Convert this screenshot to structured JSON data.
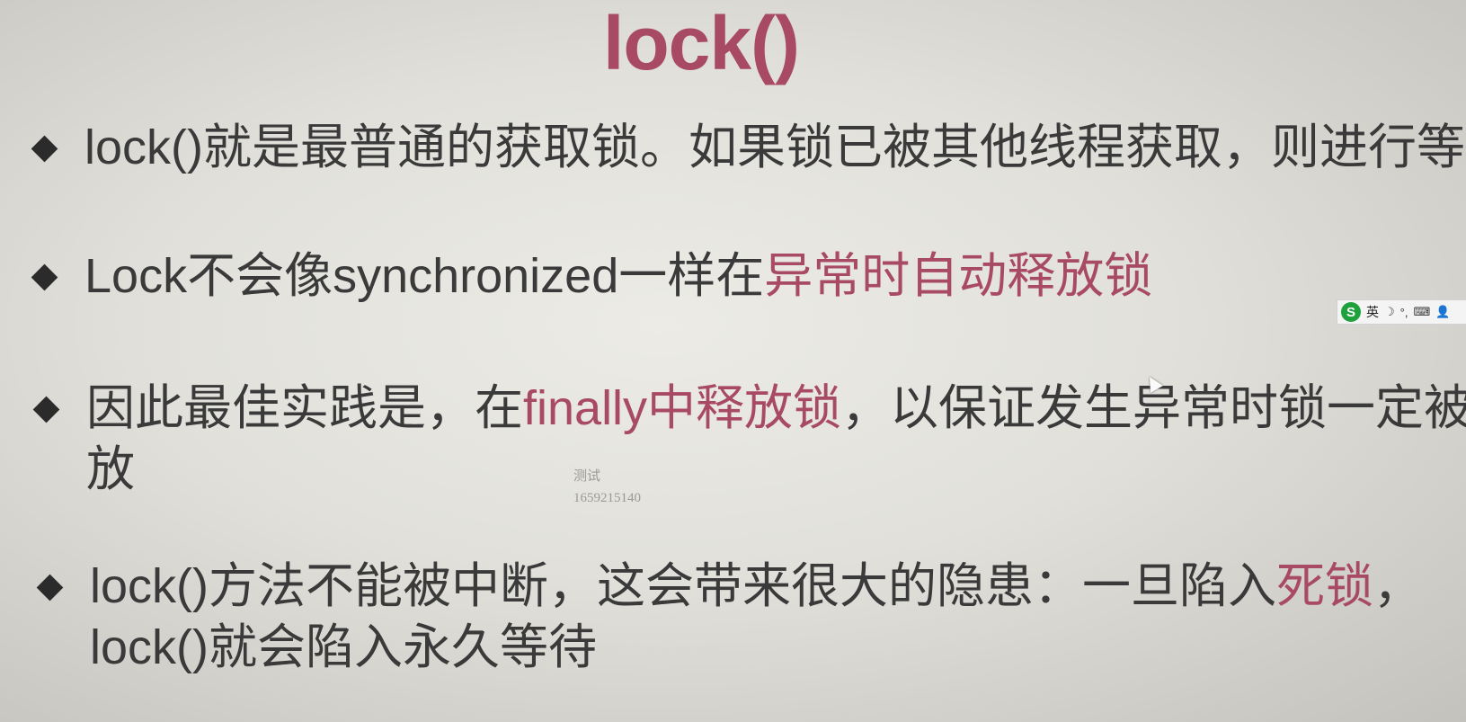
{
  "slide": {
    "title": "lock()",
    "bullets": [
      {
        "segments": [
          {
            "text": "lock()就是最普通的获取锁。如果锁已被其他线程获取，则进行等待",
            "highlight": false
          }
        ]
      },
      {
        "segments": [
          {
            "text": "Lock不会像synchronized一样在",
            "highlight": false
          },
          {
            "text": "异常时自动释放锁",
            "highlight": true
          }
        ]
      },
      {
        "segments": [
          {
            "text": "因此最佳实践是，在",
            "highlight": false
          },
          {
            "text": "finally中释放锁",
            "highlight": true
          },
          {
            "text": "，以保证发生异常时锁一定被释",
            "highlight": false
          }
        ],
        "line2": "放"
      },
      {
        "segments": [
          {
            "text": "lock()方法不能被中断，这会带来很大的隐患：一旦陷入",
            "highlight": false
          },
          {
            "text": "死锁",
            "highlight": true
          },
          {
            "text": "，",
            "highlight": false
          }
        ],
        "line2": "lock()就会陷入永久等待"
      }
    ],
    "highlight_color": "#a84a64"
  },
  "watermark": {
    "line1": "测试",
    "line2": "1659215140"
  },
  "ime_toolbar": {
    "logo_icon": "sogou-logo-icon",
    "logo_letter": "S",
    "mode_label": "英",
    "icons": [
      "moon-icon",
      "punctuation-icon",
      "keyboard-icon",
      "user-icon"
    ]
  }
}
